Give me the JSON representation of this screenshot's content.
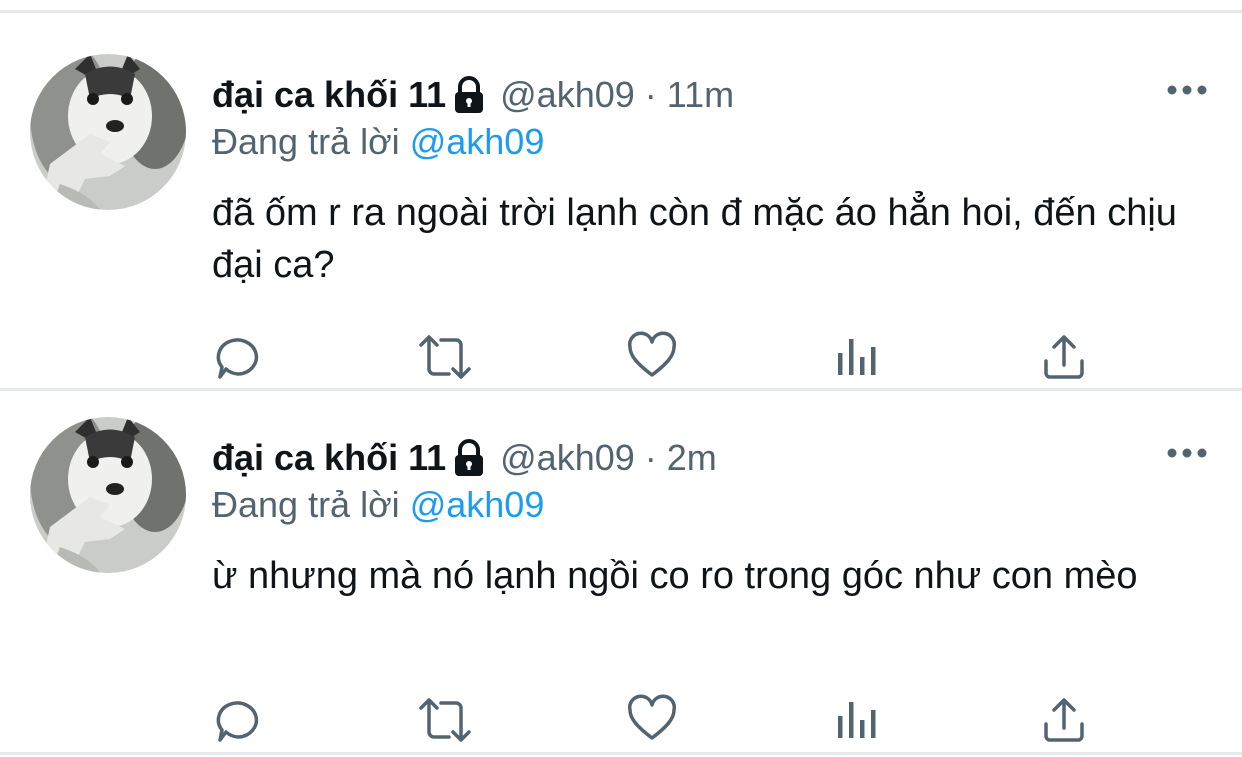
{
  "tweets": [
    {
      "display_name": "đại ca khối 11",
      "handle": "@akh09",
      "separator": "·",
      "time": "11m",
      "reply_prefix": "Đang trả lời",
      "reply_to": "@akh09",
      "text": "đã ốm r ra ngoài trời lạnh còn đ mặc áo hẳn hoi, đến chịu đại ca?"
    },
    {
      "display_name": "đại ca khối 11",
      "handle": "@akh09",
      "separator": "·",
      "time": "2m",
      "reply_prefix": "Đang trả lời",
      "reply_to": "@akh09",
      "text": "ừ nhưng mà nó lạnh ngồi co ro trong góc như con mèo"
    }
  ],
  "icons": {
    "more": "more-horizontal-icon",
    "lock": "lock-icon",
    "reply": "reply-icon",
    "retweet": "retweet-icon",
    "like": "heart-icon",
    "analytics": "analytics-icon",
    "share": "share-icon"
  },
  "colors": {
    "text": "#0f1419",
    "secondary": "#536471",
    "mention": "#1d9bf0",
    "divider": "#e6e9ec"
  }
}
